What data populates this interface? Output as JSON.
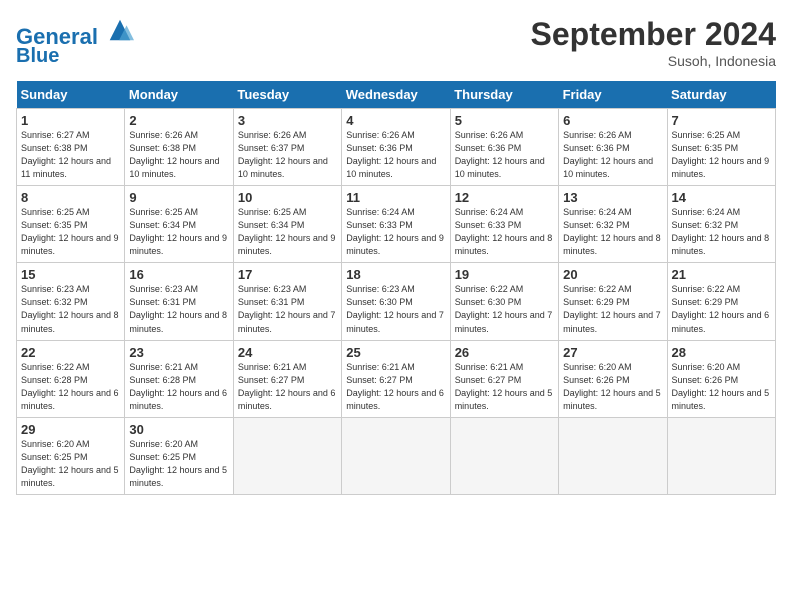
{
  "header": {
    "logo_line1": "General",
    "logo_line2": "Blue",
    "month_title": "September 2024",
    "location": "Susoh, Indonesia"
  },
  "days_of_week": [
    "Sunday",
    "Monday",
    "Tuesday",
    "Wednesday",
    "Thursday",
    "Friday",
    "Saturday"
  ],
  "weeks": [
    [
      {
        "num": "1",
        "rise": "6:27 AM",
        "set": "6:38 PM",
        "daylight": "12 hours and 11 minutes."
      },
      {
        "num": "2",
        "rise": "6:26 AM",
        "set": "6:38 PM",
        "daylight": "12 hours and 10 minutes."
      },
      {
        "num": "3",
        "rise": "6:26 AM",
        "set": "6:37 PM",
        "daylight": "12 hours and 10 minutes."
      },
      {
        "num": "4",
        "rise": "6:26 AM",
        "set": "6:36 PM",
        "daylight": "12 hours and 10 minutes."
      },
      {
        "num": "5",
        "rise": "6:26 AM",
        "set": "6:36 PM",
        "daylight": "12 hours and 10 minutes."
      },
      {
        "num": "6",
        "rise": "6:26 AM",
        "set": "6:36 PM",
        "daylight": "12 hours and 10 minutes."
      },
      {
        "num": "7",
        "rise": "6:25 AM",
        "set": "6:35 PM",
        "daylight": "12 hours and 9 minutes."
      }
    ],
    [
      {
        "num": "8",
        "rise": "6:25 AM",
        "set": "6:35 PM",
        "daylight": "12 hours and 9 minutes."
      },
      {
        "num": "9",
        "rise": "6:25 AM",
        "set": "6:34 PM",
        "daylight": "12 hours and 9 minutes."
      },
      {
        "num": "10",
        "rise": "6:25 AM",
        "set": "6:34 PM",
        "daylight": "12 hours and 9 minutes."
      },
      {
        "num": "11",
        "rise": "6:24 AM",
        "set": "6:33 PM",
        "daylight": "12 hours and 9 minutes."
      },
      {
        "num": "12",
        "rise": "6:24 AM",
        "set": "6:33 PM",
        "daylight": "12 hours and 8 minutes."
      },
      {
        "num": "13",
        "rise": "6:24 AM",
        "set": "6:32 PM",
        "daylight": "12 hours and 8 minutes."
      },
      {
        "num": "14",
        "rise": "6:24 AM",
        "set": "6:32 PM",
        "daylight": "12 hours and 8 minutes."
      }
    ],
    [
      {
        "num": "15",
        "rise": "6:23 AM",
        "set": "6:32 PM",
        "daylight": "12 hours and 8 minutes."
      },
      {
        "num": "16",
        "rise": "6:23 AM",
        "set": "6:31 PM",
        "daylight": "12 hours and 8 minutes."
      },
      {
        "num": "17",
        "rise": "6:23 AM",
        "set": "6:31 PM",
        "daylight": "12 hours and 7 minutes."
      },
      {
        "num": "18",
        "rise": "6:23 AM",
        "set": "6:30 PM",
        "daylight": "12 hours and 7 minutes."
      },
      {
        "num": "19",
        "rise": "6:22 AM",
        "set": "6:30 PM",
        "daylight": "12 hours and 7 minutes."
      },
      {
        "num": "20",
        "rise": "6:22 AM",
        "set": "6:29 PM",
        "daylight": "12 hours and 7 minutes."
      },
      {
        "num": "21",
        "rise": "6:22 AM",
        "set": "6:29 PM",
        "daylight": "12 hours and 6 minutes."
      }
    ],
    [
      {
        "num": "22",
        "rise": "6:22 AM",
        "set": "6:28 PM",
        "daylight": "12 hours and 6 minutes."
      },
      {
        "num": "23",
        "rise": "6:21 AM",
        "set": "6:28 PM",
        "daylight": "12 hours and 6 minutes."
      },
      {
        "num": "24",
        "rise": "6:21 AM",
        "set": "6:27 PM",
        "daylight": "12 hours and 6 minutes."
      },
      {
        "num": "25",
        "rise": "6:21 AM",
        "set": "6:27 PM",
        "daylight": "12 hours and 6 minutes."
      },
      {
        "num": "26",
        "rise": "6:21 AM",
        "set": "6:27 PM",
        "daylight": "12 hours and 5 minutes."
      },
      {
        "num": "27",
        "rise": "6:20 AM",
        "set": "6:26 PM",
        "daylight": "12 hours and 5 minutes."
      },
      {
        "num": "28",
        "rise": "6:20 AM",
        "set": "6:26 PM",
        "daylight": "12 hours and 5 minutes."
      }
    ],
    [
      {
        "num": "29",
        "rise": "6:20 AM",
        "set": "6:25 PM",
        "daylight": "12 hours and 5 minutes."
      },
      {
        "num": "30",
        "rise": "6:20 AM",
        "set": "6:25 PM",
        "daylight": "12 hours and 5 minutes."
      },
      null,
      null,
      null,
      null,
      null
    ]
  ]
}
